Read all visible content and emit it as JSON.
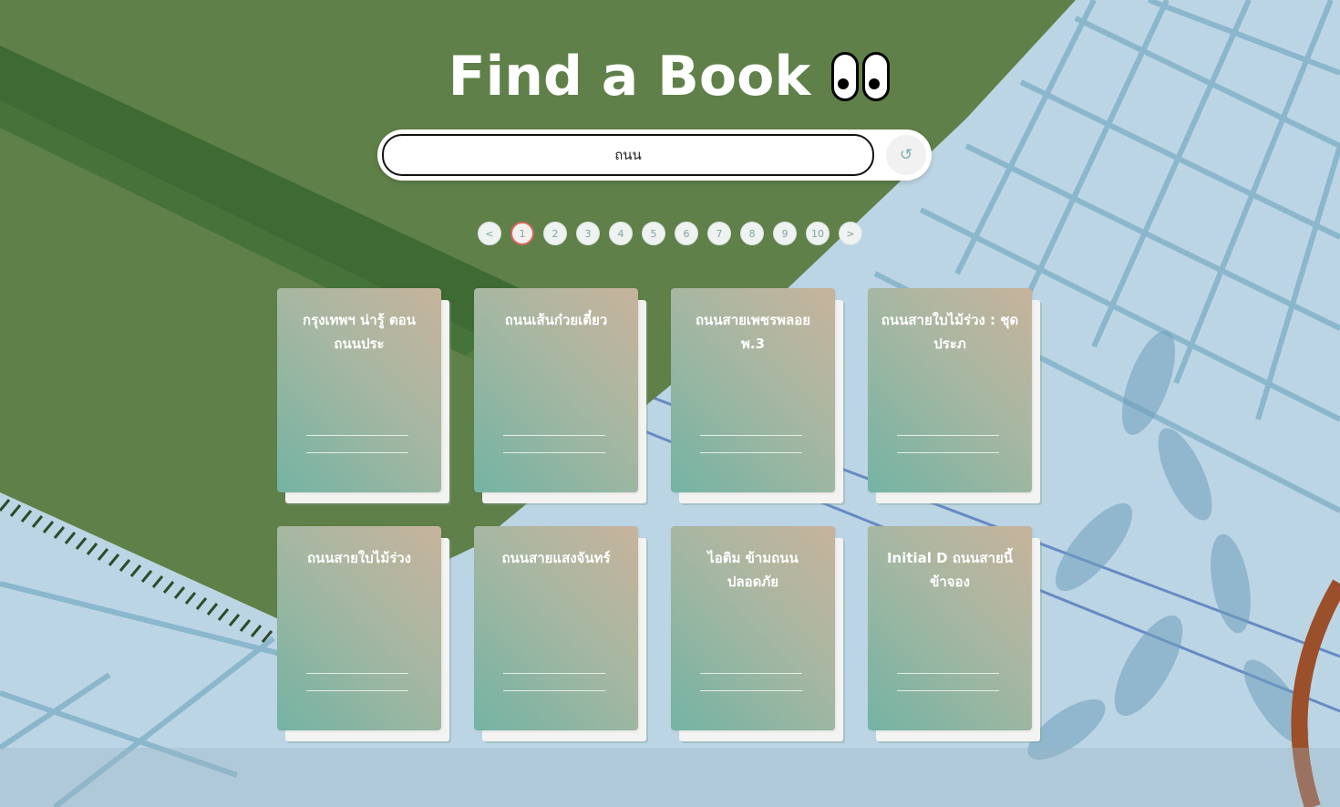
{
  "header": {
    "title": "Find a Book"
  },
  "search": {
    "value": "ถนน",
    "reset_icon": "↺"
  },
  "pagination": {
    "prev": "<",
    "next": ">",
    "pages": [
      "1",
      "2",
      "3",
      "4",
      "5",
      "6",
      "7",
      "8",
      "9",
      "10"
    ],
    "current": "1"
  },
  "books": [
    {
      "title": "กรุงเทพฯ น่ารู้ ตอน ถนนประ"
    },
    {
      "title": "ถนนเส้นก๋วยเตี๋ยว"
    },
    {
      "title": "ถนนสายเพชรพลอย พ.3"
    },
    {
      "title": "ถนนสายใบไม้ร่วง : ชุดประภ"
    },
    {
      "title": "ถนนสายใบไม้ร่วง"
    },
    {
      "title": "ถนนสายแสงจันทร์"
    },
    {
      "title": "ไอติม ข้ามถนนปลอดภัย"
    },
    {
      "title": "Initial D ถนนสายนี้ข้าจอง"
    }
  ],
  "colors": {
    "grass": "#5f8048",
    "stripe": "#3f6a33",
    "tile": "#b9d3e3",
    "grout": "#7fb0c6",
    "book_cover_top": "#c7b39c",
    "book_cover_bottom": "#74b3a3",
    "active_page_ring": "#d5665f"
  },
  "icons": {
    "eyes": "eyes-icon",
    "reset": "refresh-icon"
  }
}
